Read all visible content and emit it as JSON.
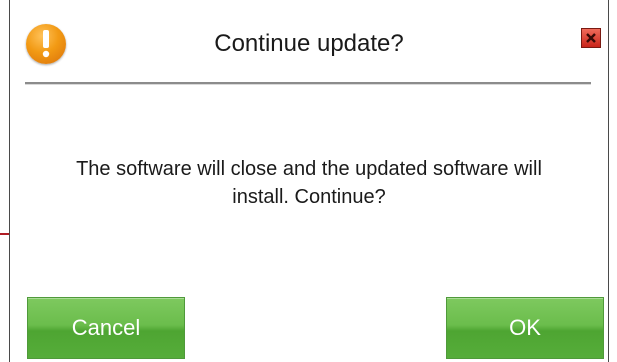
{
  "dialog": {
    "title": "Continue update?",
    "message_line1": "The software will close and the updated software will",
    "message_line2": "install. Continue?",
    "icons": {
      "warning": "warning-icon",
      "close": "close-icon"
    },
    "buttons": {
      "cancel_label": "Cancel",
      "ok_label": "OK"
    }
  },
  "annotation": {
    "arrow": "arrow-right-icon",
    "color": "#b01c24"
  },
  "colors": {
    "button_green": "#5fb444",
    "warning_orange": "#f29a14",
    "close_red": "#d8352a"
  }
}
